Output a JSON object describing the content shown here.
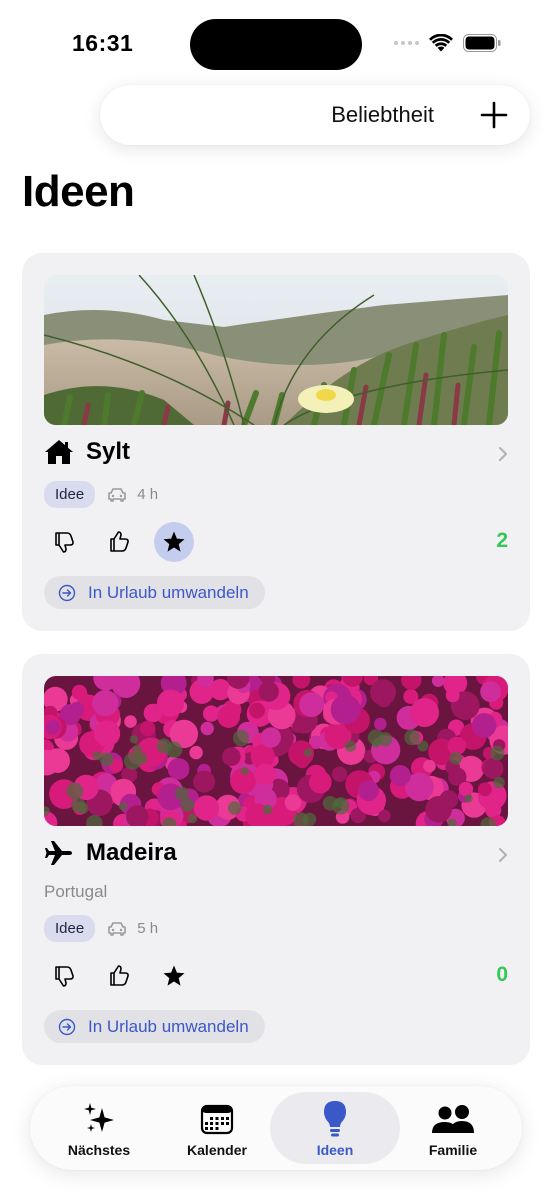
{
  "status_bar": {
    "time": "16:31"
  },
  "toolbar": {
    "sort_label": "Beliebtheit"
  },
  "page_title": "Ideen",
  "cards": [
    {
      "title": "Sylt",
      "title_icon": "house-icon",
      "subtitle": "",
      "badge": "Idee",
      "travel_time": "4 h",
      "score": "2",
      "starred": true,
      "convert_label": "In Urlaub umwandeln"
    },
    {
      "title": "Madeira",
      "title_icon": "airplane-icon",
      "subtitle": "Portugal",
      "badge": "Idee",
      "travel_time": "5 h",
      "score": "0",
      "starred": false,
      "convert_label": "In Urlaub umwandeln"
    }
  ],
  "tabs": [
    {
      "label": "Nächstes",
      "icon": "sparkles-icon"
    },
    {
      "label": "Kalender",
      "icon": "calendar-icon"
    },
    {
      "label": "Ideen",
      "icon": "lightbulb-icon",
      "active": true
    },
    {
      "label": "Familie",
      "icon": "people-icon"
    }
  ],
  "colors": {
    "accent": "#3a58c8",
    "score_green": "#34c759",
    "card_bg": "#f1f1f3",
    "badge_bg": "#d8dcee",
    "star_active_bg": "#c5cdef"
  }
}
